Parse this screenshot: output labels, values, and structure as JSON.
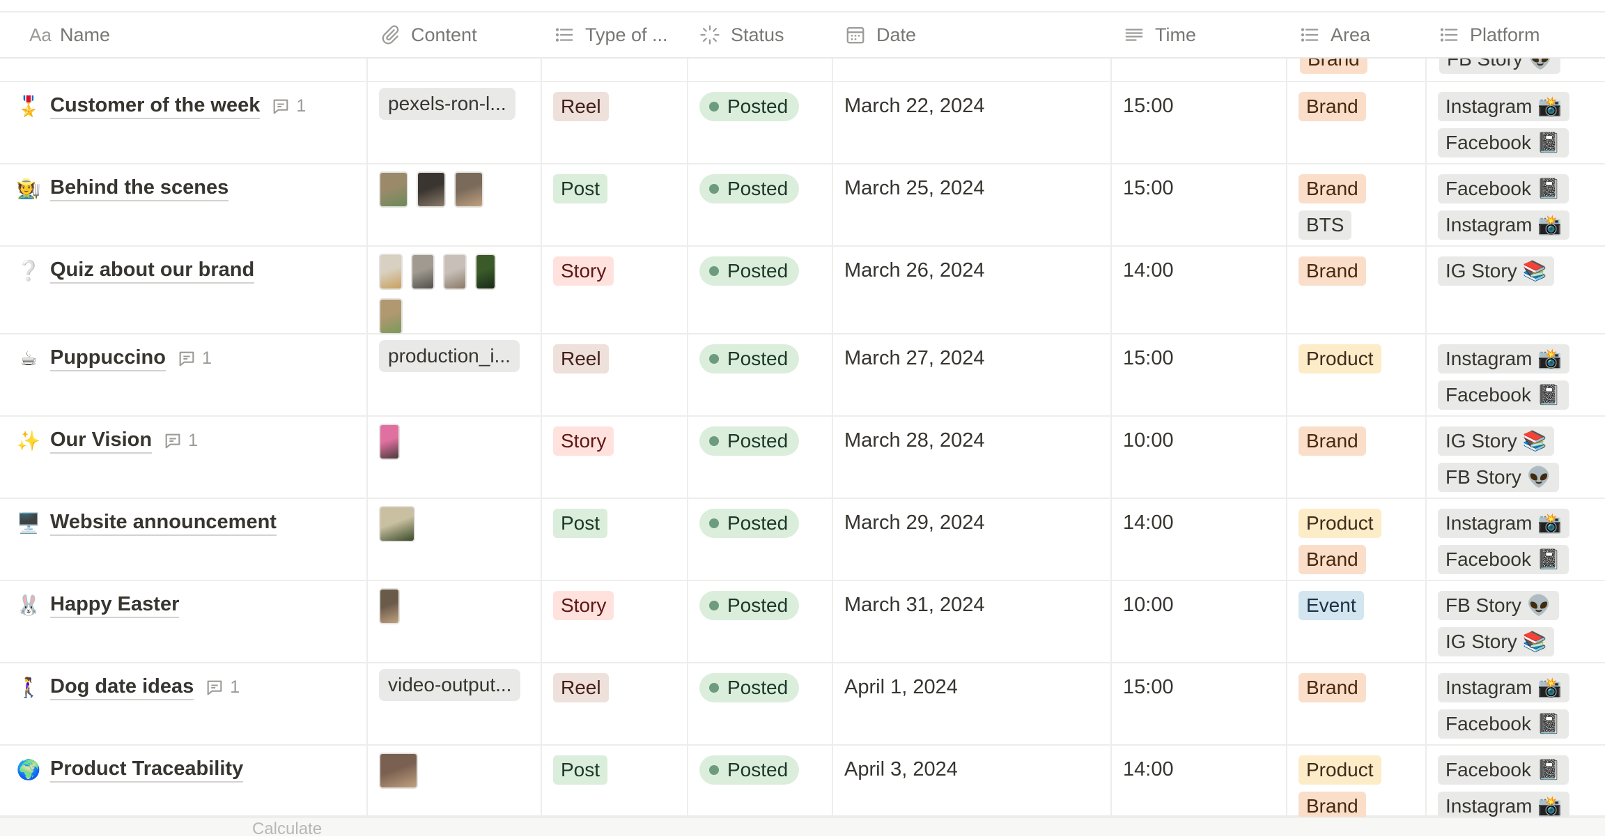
{
  "columns": [
    {
      "key": "name",
      "label": "Name",
      "icon": "text-aa-icon"
    },
    {
      "key": "content",
      "label": "Content",
      "icon": "paperclip-icon"
    },
    {
      "key": "type",
      "label": "Type of ...",
      "icon": "list-icon"
    },
    {
      "key": "status",
      "label": "Status",
      "icon": "status-spinner-icon"
    },
    {
      "key": "date",
      "label": "Date",
      "icon": "calendar-icon"
    },
    {
      "key": "time",
      "label": "Time",
      "icon": "text-lines-icon"
    },
    {
      "key": "area",
      "label": "Area",
      "icon": "list-icon"
    },
    {
      "key": "platform",
      "label": "Platform",
      "icon": "list-icon"
    }
  ],
  "partial_row": {
    "area": "Brand",
    "platform": "FB Story 👽"
  },
  "rows": [
    {
      "emoji": "🎖️",
      "name": "Customer of the week",
      "comments": "1",
      "content_file": "pexels-ron-l...",
      "type": "Reel",
      "status": "Posted",
      "date": "March 22, 2024",
      "time": "15:00",
      "area": [
        "Brand"
      ],
      "platform": [
        "Instagram 📸",
        "Facebook 📓"
      ]
    },
    {
      "emoji": "🧑‍🌾",
      "name": "Behind the scenes",
      "comments": "",
      "content_thumbs": [
        "photo-1",
        "photo-2",
        "photo-3"
      ],
      "type": "Post",
      "status": "Posted",
      "date": "March 25, 2024",
      "time": "15:00",
      "area": [
        "Brand",
        "BTS"
      ],
      "platform": [
        "Facebook 📓",
        "Instagram 📸"
      ]
    },
    {
      "emoji": "❔",
      "name": "Quiz about our brand",
      "comments": "",
      "content_thumbs": [
        "photo-4",
        "photo-5",
        "photo-6",
        "photo-7",
        "photo-8"
      ],
      "type": "Story",
      "status": "Posted",
      "date": "March 26, 2024",
      "time": "14:00",
      "area": [
        "Brand"
      ],
      "platform": [
        "IG Story 📚"
      ]
    },
    {
      "emoji": "☕",
      "name": "Puppuccino",
      "comments": "1",
      "content_file": "production_i...",
      "type": "Reel",
      "status": "Posted",
      "date": "March 27, 2024",
      "time": "15:00",
      "area": [
        "Product"
      ],
      "platform": [
        "Instagram 📸",
        "Facebook 📓"
      ]
    },
    {
      "emoji": "✨",
      "name": "Our Vision",
      "comments": "1",
      "content_thumbs": [
        "photo-9"
      ],
      "type": "Story",
      "status": "Posted",
      "date": "March 28, 2024",
      "time": "10:00",
      "area": [
        "Brand"
      ],
      "platform": [
        "IG Story 📚",
        "FB Story 👽"
      ]
    },
    {
      "emoji": "🖥️",
      "name": "Website announcement",
      "comments": "",
      "content_thumbs": [
        "photo-10"
      ],
      "type": "Post",
      "status": "Posted",
      "date": "March 29, 2024",
      "time": "14:00",
      "area": [
        "Product",
        "Brand"
      ],
      "platform": [
        "Instagram 📸",
        "Facebook 📓"
      ]
    },
    {
      "emoji": "🐰",
      "name": "Happy Easter",
      "comments": "",
      "content_thumbs": [
        "photo-11"
      ],
      "type": "Story",
      "status": "Posted",
      "date": "March 31, 2024",
      "time": "10:00",
      "area": [
        "Event"
      ],
      "platform": [
        "FB Story 👽",
        "IG Story 📚"
      ]
    },
    {
      "emoji": "🚶‍♀️",
      "name": "Dog date ideas",
      "comments": "1",
      "content_file": "video-output...",
      "type": "Reel",
      "status": "Posted",
      "date": "April 1, 2024",
      "time": "15:00",
      "area": [
        "Brand"
      ],
      "platform": [
        "Instagram 📸",
        "Facebook 📓"
      ]
    },
    {
      "emoji": "🌍",
      "name": "Product Traceability",
      "comments": "",
      "content_thumbs": [
        "photo-12"
      ],
      "type": "Post",
      "status": "Posted",
      "date": "April 3, 2024",
      "time": "14:00",
      "area": [
        "Product",
        "Brand"
      ],
      "platform": [
        "Facebook 📓",
        "Instagram 📸"
      ]
    }
  ],
  "footer": {
    "label": "Calculate"
  },
  "colors": {
    "Reel": {
      "bg": "#eee0da",
      "fg": "#44201a"
    },
    "Post": {
      "bg": "#dbeddb",
      "fg": "#1c3829"
    },
    "Story": {
      "bg": "#ffe2dd",
      "fg": "#5d1715"
    },
    "Brand": {
      "bg": "#fadec9",
      "fg": "#49290e"
    },
    "BTS": {
      "bg": "#e9e9e7",
      "fg": "#37352f"
    },
    "Product": {
      "bg": "#fdecc8",
      "fg": "#402c1b"
    },
    "Event": {
      "bg": "#d3e5ef",
      "fg": "#183347"
    },
    "platform": {
      "bg": "#e9e9e7",
      "fg": "#37352f"
    },
    "status_bg": "#dbeddb",
    "status_dot": "#6c9b7d"
  }
}
